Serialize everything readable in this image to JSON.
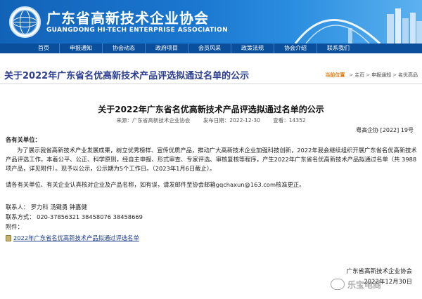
{
  "header": {
    "title": "广东省高新技术企业协会",
    "subtitle": "GUANGDONG HI-TECH ENTERPRISE ASSOCIATION"
  },
  "nav": {
    "items": [
      {
        "label": "首页"
      },
      {
        "label": "申报通知"
      },
      {
        "label": "协会动态"
      },
      {
        "label": "政府项目"
      },
      {
        "label": "会员风采"
      },
      {
        "label": "政策法规"
      },
      {
        "label": "协会介绍"
      },
      {
        "label": "联系我们"
      }
    ]
  },
  "page": {
    "title": "关于2022年广东省名优高新技术产品评选拟通过名单的公示"
  },
  "breadcrumb": {
    "lead": "当前位置",
    "sep": ">",
    "items": [
      "主页",
      "申报通知",
      "名优高品"
    ]
  },
  "article": {
    "title": "关于2022年广东省名优高新技术产品评选拟通过名单的公示",
    "meta": {
      "source": "来源：广东省高新技术企业协会",
      "date": "发布日期：2022-12-30",
      "views": "查看：14352"
    },
    "doc_no": "粤高企协 [2022] 19号",
    "salutation": "各有关单位：",
    "para1": "为了展示我省高新技术产业发展成果，树立优秀榜样、宣传优质产品，推动广大高新技术企业加强科技创新，2022年我会继续组织开展广东省名优高新技术产品评选工作。本着公平、公正、科学原则，经自主申报、形式审查、专家评选、审核复核等程序，产生2022年广东省名优高新技术产品拟通过名单（共 3988项产品，详见附件）。现予以公示，公示期为5个工作日。（2023年1月6日截止）。",
    "para2": "请各有关单位、有关企业认真核对企业及产品名称，如有误，请发邮件至协会邮箱gqchaxun@163.com核准更正。",
    "contact_person": "联系人：   罗力科  汤键勇  钟嘉健",
    "contact_phone": "联系方式：  020-37856321  38458076  38458669",
    "attach_label": "附件：",
    "attachment": "2022年广东省名优高新技术产品拟通过评选名单",
    "sign_org": "广东省高新技术企业协会",
    "sign_date": "2022年12月30日"
  },
  "watermark": {
    "text": "乐宝电商"
  },
  "colors": {
    "header_blue": "#1263b8",
    "nav_blue": "#0a4f9c",
    "title_color": "#2c3e8f",
    "breadcrumb_lead": "#e07a10",
    "link_color": "#1a3c8a"
  }
}
